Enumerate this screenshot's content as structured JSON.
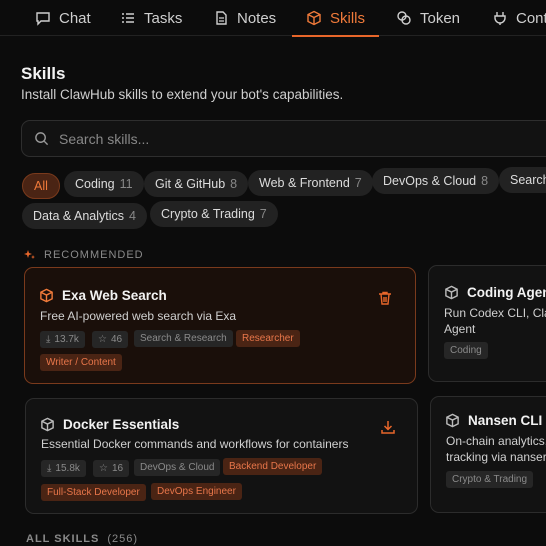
{
  "nav": {
    "tabs": [
      {
        "label": "Chat",
        "icon": "chat-bubble-icon"
      },
      {
        "label": "Tasks",
        "icon": "list-icon"
      },
      {
        "label": "Notes",
        "icon": "document-icon"
      },
      {
        "label": "Skills",
        "icon": "cube-icon",
        "active": true
      },
      {
        "label": "Token",
        "icon": "coins-icon"
      },
      {
        "label": "Contr",
        "icon": "plug-icon"
      }
    ]
  },
  "header": {
    "title": "Skills",
    "subtitle": "Install ClawHub skills to extend your bot's capabilities."
  },
  "search": {
    "placeholder": "Search skills..."
  },
  "filters": [
    {
      "label": "All",
      "count": ""
    },
    {
      "label": "Coding",
      "count": "11"
    },
    {
      "label": "Git & GitHub",
      "count": "8"
    },
    {
      "label": "Web & Frontend",
      "count": "7"
    },
    {
      "label": "DevOps & Cloud",
      "count": "8"
    },
    {
      "label": "Search",
      "count": ""
    },
    {
      "label": "Data & Analytics",
      "count": "4"
    },
    {
      "label": "Crypto & Trading",
      "count": "7"
    }
  ],
  "recommended": {
    "label": "RECOMMENDED"
  },
  "cards": [
    {
      "title": "Exa Web Search",
      "desc": "Free AI-powered web search via Exa",
      "downloads": "13.7k",
      "stars": "46",
      "category": "Search & Research",
      "roles": [
        "Researcher",
        "Writer / Content"
      ],
      "action": "trash-icon"
    },
    {
      "title": "Coding Agent",
      "desc": "Run Codex CLI, Cla",
      "desc2": "Agent",
      "category": "Coding"
    },
    {
      "title": "Docker Essentials",
      "desc": "Essential Docker commands and workflows for containers",
      "downloads": "15.8k",
      "stars": "16",
      "category": "DevOps & Cloud",
      "roles": [
        "Backend Developer",
        "Full-Stack Developer",
        "DevOps Engineer"
      ],
      "action": "download-icon"
    },
    {
      "title": "Nansen CLI",
      "desc": "On-chain analytics,",
      "desc2": "tracking via nanser",
      "category": "Crypto & Trading"
    }
  ],
  "all_skills": {
    "label": "ALL SKILLS",
    "count": "(256)"
  },
  "colors": {
    "accent": "#f07a3a",
    "background": "#0c0c0c",
    "role_tag": "#4a2414"
  }
}
